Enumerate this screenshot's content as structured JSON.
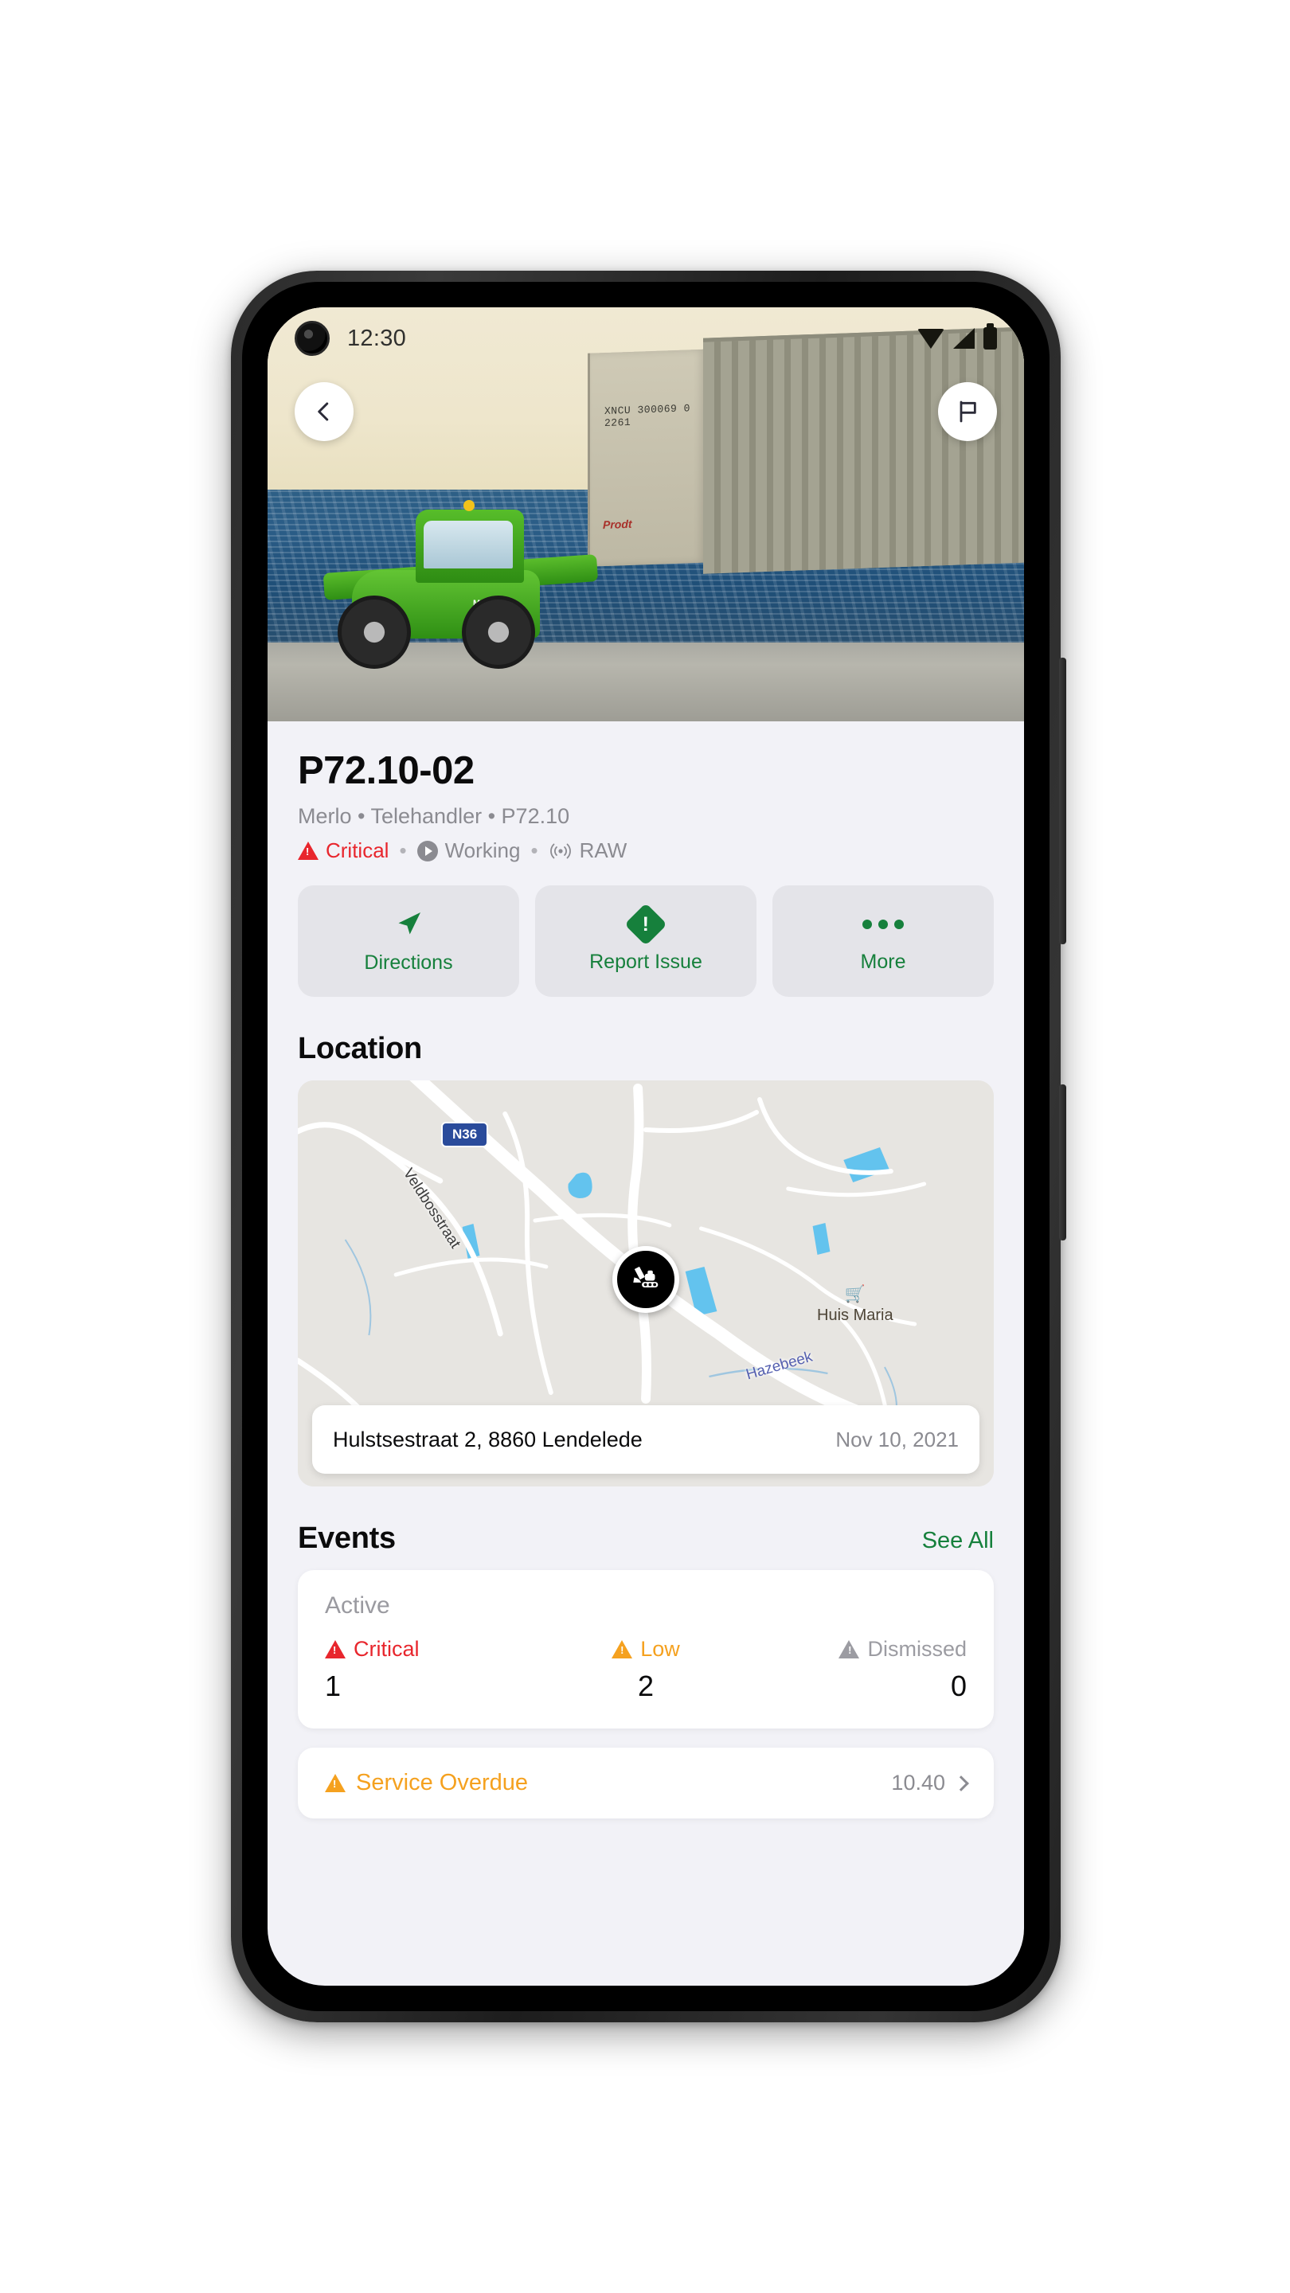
{
  "status_bar": {
    "time": "12:30",
    "icons": [
      "wifi-icon",
      "cellular-signal-icon",
      "battery-icon"
    ]
  },
  "hero": {
    "back_button": "back-chevron-icon",
    "flag_button": "flag-icon",
    "container_code_line1": "XNCU 300069 0",
    "container_code_line2": "2261",
    "container_logo": "Prodt",
    "machine_brand": "MERLO"
  },
  "asset": {
    "title": "P72.10-02",
    "subtitle": "Merlo • Telehandler • P72.10",
    "status": {
      "condition": "Critical",
      "operation": "Working",
      "signal": "RAW",
      "separator": "•"
    }
  },
  "actions": [
    {
      "label": "Directions",
      "icon": "navigation-arrow-icon"
    },
    {
      "label": "Report Issue",
      "icon": "alert-diamond-icon"
    },
    {
      "label": "More",
      "icon": "ellipsis-icon"
    }
  ],
  "location": {
    "heading": "Location",
    "address": "Hulstsestraat 2, 8860 Lendelede",
    "date": "Nov 10, 2021",
    "map": {
      "road_badge": "N36",
      "street_label": "Veldbosstraat",
      "water_label": "Hazebeek",
      "poi_name": "Huis Maria",
      "poi_icon": "shopping-cart-icon",
      "marker_icon": "excavator-icon"
    }
  },
  "events": {
    "heading": "Events",
    "see_all": "See All",
    "active": {
      "label": "Active",
      "severities": [
        {
          "label": "Critical",
          "count": "1",
          "color": "#e8262d"
        },
        {
          "label": "Low",
          "count": "2",
          "color": "#f5a11f"
        },
        {
          "label": "Dismissed",
          "count": "0",
          "color": "#9c9ca2"
        }
      ]
    },
    "overdue": {
      "label": "Service Overdue",
      "value": "10.40",
      "chevron": "chevron-right-icon"
    }
  },
  "colors": {
    "accent_green": "#16803c",
    "critical_red": "#e8262d",
    "warning_orange": "#f5a11f",
    "muted_gray": "#8b8b91",
    "page_bg": "#f2f2f7"
  }
}
